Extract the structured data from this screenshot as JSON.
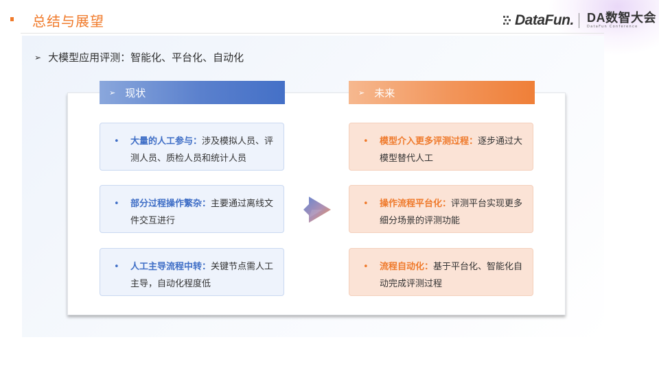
{
  "header": {
    "title": "总结与展望",
    "logo_datafun": "DataFun.",
    "logo_da_main": "DA数智大会",
    "logo_da_sub": "DataFun Conference"
  },
  "subtitle": "大模型应用评测：智能化、平台化、自动化",
  "left_column": {
    "header": "现状",
    "items": [
      {
        "emphasis": "大量的人工参与：",
        "text": "涉及模拟人员、评测人员、质检人员和统计人员"
      },
      {
        "emphasis": "部分过程操作繁杂：",
        "text": "主要通过离线文件交互进行"
      },
      {
        "emphasis": "人工主导流程中转：",
        "text": "关键节点需人工主导，自动化程度低"
      }
    ]
  },
  "right_column": {
    "header": "未来",
    "items": [
      {
        "emphasis": "模型介入更多评测过程：",
        "text": "逐步通过大模型替代人工"
      },
      {
        "emphasis": "操作流程平台化：",
        "text": "评测平台实现更多细分场景的评测功能"
      },
      {
        "emphasis": "流程自动化：",
        "text": "基于平台化、智能化自动完成评测过程"
      }
    ]
  },
  "icons": {
    "bullet_arrow": "➢",
    "list_bullet": "•",
    "transition": "right-arrow-icon"
  },
  "colors": {
    "accent_orange": "#f07a2a",
    "accent_blue": "#4470c7",
    "left_box_bg": "#eef3fc",
    "right_box_bg": "#fbe3d6"
  }
}
